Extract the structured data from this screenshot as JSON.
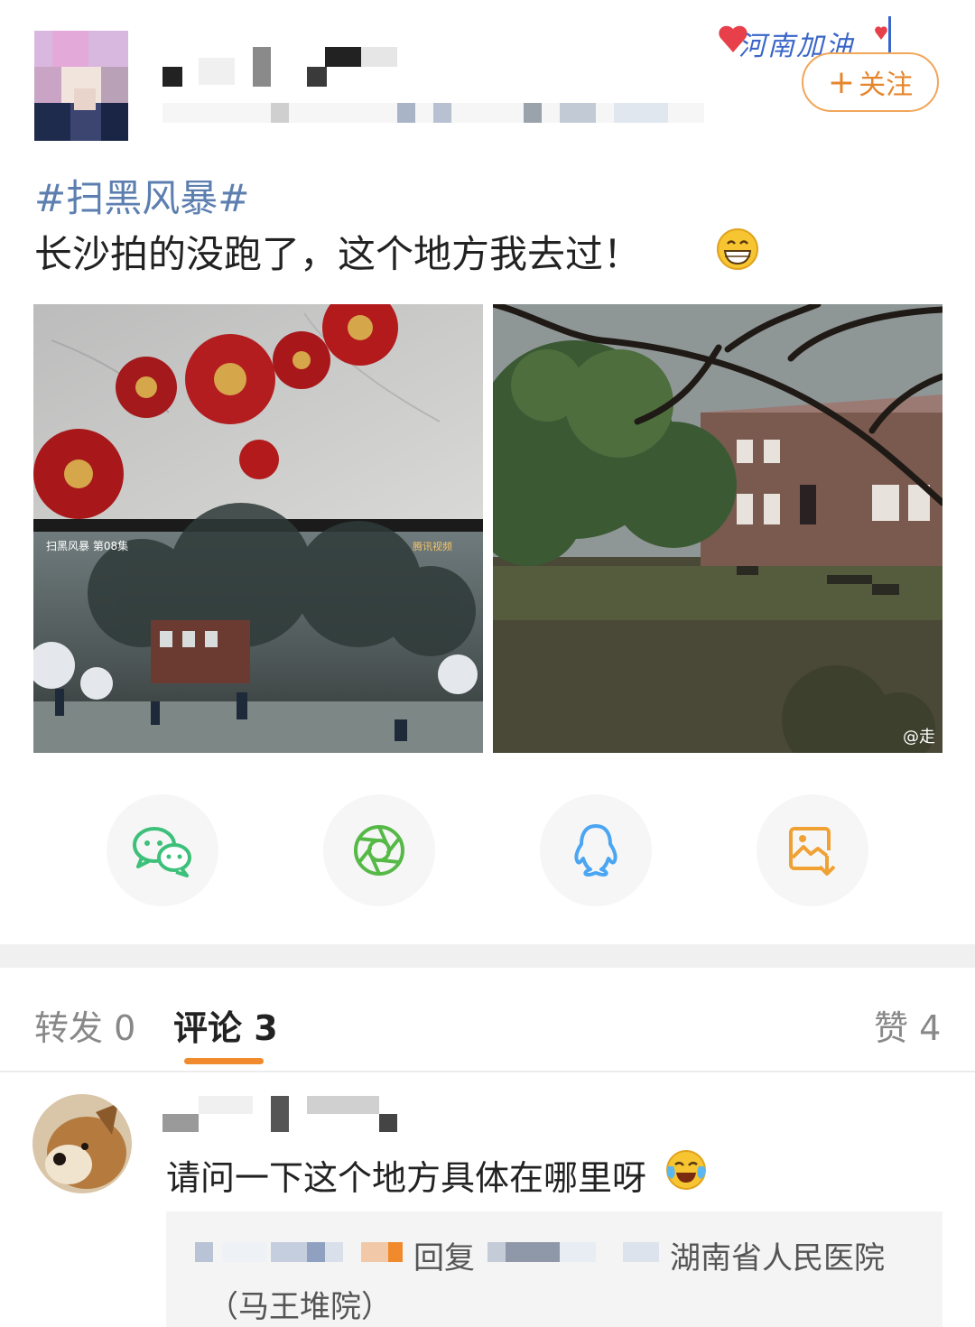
{
  "header": {
    "badge_text": "河南加油",
    "follow_label": "关注",
    "follow_icon": "plus-icon"
  },
  "post": {
    "hashtag": "#扫黑风暴#",
    "text": "长沙拍的没跑了，这个地方我去过！",
    "emoji": "grinning-face-icon",
    "images": [
      {
        "overlay_left": "扫黑风暴 第08集",
        "overlay_right": "腾讯视频"
      },
      {
        "watermark": "@走"
      }
    ]
  },
  "share": {
    "icons": [
      "wechat-icon",
      "moments-icon",
      "qq-icon",
      "save-image-icon"
    ],
    "colors": {
      "wechat": "#3cc07a",
      "moments": "#56b947",
      "qq": "#4aa6f3",
      "save": "#f0a134"
    }
  },
  "tabs": {
    "repost_label": "转发",
    "repost_count": "0",
    "comment_label": "评论",
    "comment_count": "3",
    "like_label": "赞",
    "like_count": "4",
    "accent": "#f08a2c"
  },
  "comment": {
    "text": "请问一下这个地方具体在哪里呀",
    "emoji": "laughing-crying-icon",
    "reply": {
      "reply_word": "回复",
      "text_line1": "湖南省人民医院",
      "text_line2": "（马王堆院）"
    }
  }
}
